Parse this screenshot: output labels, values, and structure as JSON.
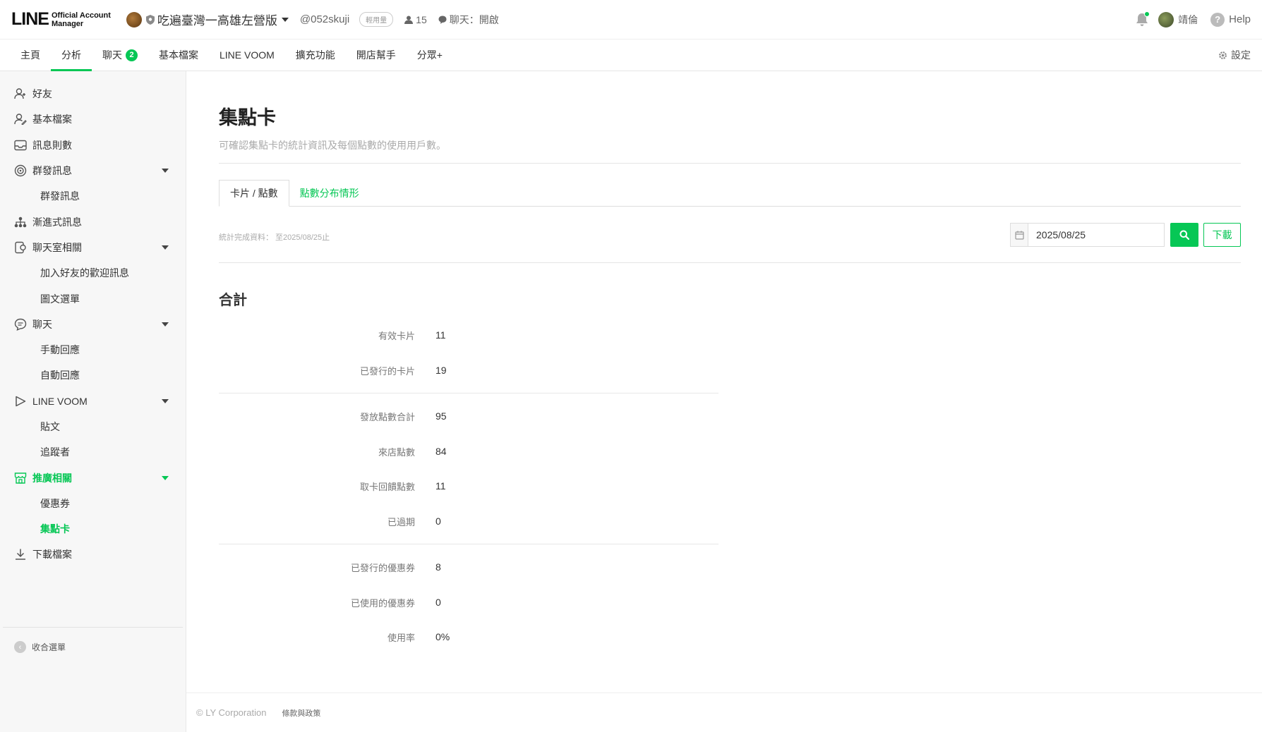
{
  "header": {
    "logo_text": "LINE",
    "logo_sub_1": "Official Account",
    "logo_sub_2": "Manager",
    "account_name": "吃遍臺灣一高雄左營版",
    "account_id": "@052skuji",
    "plan_badge": "輕用量",
    "friend_count": "15",
    "chat_status": "聊天：開啟",
    "user_name": "靖倫",
    "help_label": "Help"
  },
  "nav": {
    "tabs": [
      {
        "label": "主頁"
      },
      {
        "label": "分析"
      },
      {
        "label": "聊天",
        "badge": "2"
      },
      {
        "label": "基本檔案"
      },
      {
        "label": "LINE VOOM"
      },
      {
        "label": "擴充功能"
      },
      {
        "label": "開店幫手"
      },
      {
        "label": "分眾+"
      }
    ],
    "active_index": 1,
    "settings_label": "設定"
  },
  "sidebar": {
    "items": [
      {
        "label": "好友",
        "icon": "friends-icon"
      },
      {
        "label": "基本檔案",
        "icon": "profile-icon"
      },
      {
        "label": "訊息則數",
        "icon": "inbox-icon"
      },
      {
        "label": "群發訊息",
        "icon": "broadcast-icon",
        "expandable": true
      },
      {
        "label": "群發訊息",
        "sub": true
      },
      {
        "label": "漸進式訊息",
        "icon": "step-message-icon"
      },
      {
        "label": "聊天室相關",
        "icon": "chatroom-icon",
        "expandable": true
      },
      {
        "label": "加入好友的歡迎訊息",
        "sub": true
      },
      {
        "label": "圖文選單",
        "sub": true
      },
      {
        "label": "聊天",
        "icon": "chat-icon",
        "expandable": true
      },
      {
        "label": "手動回應",
        "sub": true
      },
      {
        "label": "自動回應",
        "sub": true
      },
      {
        "label": "LINE VOOM",
        "icon": "voom-icon",
        "expandable": true
      },
      {
        "label": "貼文",
        "sub": true
      },
      {
        "label": "追蹤者",
        "sub": true
      },
      {
        "label": "推廣相關",
        "icon": "store-icon",
        "expandable": true,
        "highlight": true
      },
      {
        "label": "優惠券",
        "sub": true
      },
      {
        "label": "集點卡",
        "sub": true,
        "active": true
      },
      {
        "label": "下載檔案",
        "icon": "download-icon"
      }
    ],
    "collapse_label": "收合選單"
  },
  "main": {
    "title": "集點卡",
    "description": "可確認集點卡的統計資訊及每個點數的使用用戶數。",
    "tabs": [
      {
        "label": "卡片 / 點數",
        "active": true
      },
      {
        "label": "點數分布情形",
        "active": false
      }
    ],
    "stats_note": "統計完成資料： 至2025/08/25止",
    "date_value": "2025/08/25",
    "download_label": "下載",
    "section_title": "合計",
    "groups": [
      [
        {
          "label": "有效卡片",
          "value": "11"
        },
        {
          "label": "已發行的卡片",
          "value": "19"
        }
      ],
      [
        {
          "label": "發放點數合計",
          "value": "95"
        },
        {
          "label": "來店點數",
          "value": "84"
        },
        {
          "label": "取卡回饋點數",
          "value": "11"
        },
        {
          "label": "已過期",
          "value": "0"
        }
      ],
      [
        {
          "label": "已發行的優惠券",
          "value": "8"
        },
        {
          "label": "已使用的優惠券",
          "value": "0"
        },
        {
          "label": "使用率",
          "value": "0%"
        }
      ]
    ]
  },
  "footer": {
    "copyright": "© LY Corporation",
    "terms_link": "條款與政策"
  },
  "colors": {
    "accent": "#06c755",
    "text": "#333333",
    "muted": "#aaaaaa"
  }
}
